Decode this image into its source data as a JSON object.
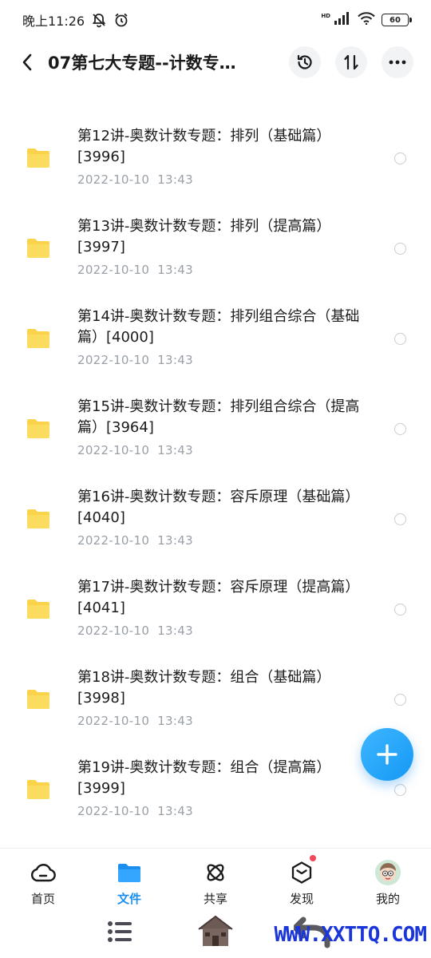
{
  "status_bar": {
    "time": "晚上11:26",
    "network": "HD",
    "battery": "60"
  },
  "header": {
    "title": "07第七大专题--计数专…"
  },
  "files": [
    {
      "name": "第12讲-奥数计数专题：排列（基础篇）[3996]",
      "date": "2022-10-10",
      "time": "13:43"
    },
    {
      "name": "第13讲-奥数计数专题：排列（提高篇）[3997]",
      "date": "2022-10-10",
      "time": "13:43"
    },
    {
      "name": "第14讲-奥数计数专题：排列组合综合（基础篇）[4000]",
      "date": "2022-10-10",
      "time": "13:43"
    },
    {
      "name": "第15讲-奥数计数专题：排列组合综合（提高篇）[3964]",
      "date": "2022-10-10",
      "time": "13:43"
    },
    {
      "name": "第16讲-奥数计数专题：容斥原理（基础篇）[4040]",
      "date": "2022-10-10",
      "time": "13:43"
    },
    {
      "name": "第17讲-奥数计数专题：容斥原理（提高篇）[4041]",
      "date": "2022-10-10",
      "time": "13:43"
    },
    {
      "name": "第18讲-奥数计数专题：组合（基础篇）[3998]",
      "date": "2022-10-10",
      "time": "13:43"
    },
    {
      "name": "第19讲-奥数计数专题：组合（提高篇）[3999]",
      "date": "2022-10-10",
      "time": "13:43"
    }
  ],
  "nav": {
    "home": "首页",
    "files": "文件",
    "share": "共享",
    "discover": "发现",
    "mine": "我的"
  },
  "watermark": "WWW.XXTTQ.COM",
  "colors": {
    "accent": "#1a8ff0",
    "folder": "#fbd34b",
    "date": "#9aa0a8",
    "badge": "#f5475c"
  }
}
